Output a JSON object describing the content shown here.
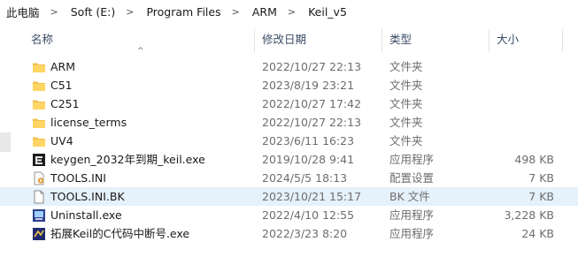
{
  "breadcrumb": [
    "此电脑",
    "Soft (E:)",
    "Program Files",
    "ARM",
    "Keil_v5"
  ],
  "columns": {
    "name": "名称",
    "date": "修改日期",
    "type": "类型",
    "size": "大小"
  },
  "files": [
    {
      "name": "ARM",
      "date": "2022/10/27 22:13",
      "type": "文件夹",
      "size": "",
      "icon": "folder-icon",
      "selected": false
    },
    {
      "name": "C51",
      "date": "2023/8/19 23:21",
      "type": "文件夹",
      "size": "",
      "icon": "folder-icon",
      "selected": false
    },
    {
      "name": "C251",
      "date": "2022/10/27 17:42",
      "type": "文件夹",
      "size": "",
      "icon": "folder-icon",
      "selected": false
    },
    {
      "name": "license_terms",
      "date": "2022/10/27 22:13",
      "type": "文件夹",
      "size": "",
      "icon": "folder-icon",
      "selected": false
    },
    {
      "name": "UV4",
      "date": "2023/6/11 16:23",
      "type": "文件夹",
      "size": "",
      "icon": "folder-icon",
      "selected": false
    },
    {
      "name": "keygen_2032年到期_keil.exe",
      "date": "2019/10/28 9:41",
      "type": "应用程序",
      "size": "498 KB",
      "icon": "keygen-app-icon",
      "selected": false
    },
    {
      "name": "TOOLS.INI",
      "date": "2024/5/5 18:13",
      "type": "配置设置",
      "size": "7 KB",
      "icon": "settings-file-icon",
      "selected": false
    },
    {
      "name": "TOOLS.INI.BK",
      "date": "2023/10/21 15:17",
      "type": "BK 文件",
      "size": "7 KB",
      "icon": "blank-file-icon",
      "selected": true
    },
    {
      "name": "Uninstall.exe",
      "date": "2022/4/10 12:55",
      "type": "应用程序",
      "size": "3,228 KB",
      "icon": "uninstall-app-icon",
      "selected": false
    },
    {
      "name": "拓展Keil的C代码中断号.exe",
      "date": "2022/3/23 8:20",
      "type": "应用程序",
      "size": "24 KB",
      "icon": "extension-app-icon",
      "selected": false
    }
  ],
  "colors": {
    "folder": "#f0c04a",
    "selection": "#e5f1fb",
    "header_text": "#3b4c66",
    "meta_text": "#6d6d6d"
  }
}
